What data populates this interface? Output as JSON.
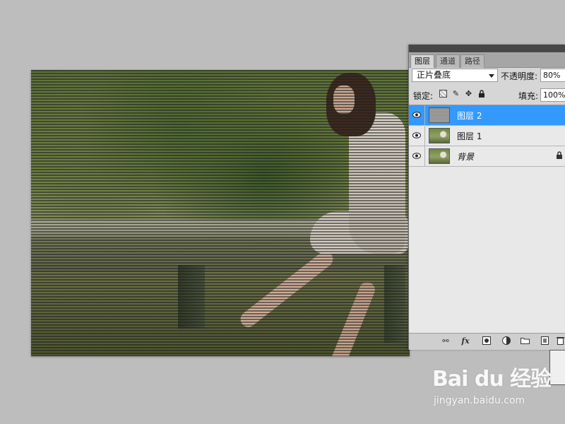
{
  "panel": {
    "tabs": [
      {
        "label": "图层",
        "active": true
      },
      {
        "label": "通道",
        "active": false
      },
      {
        "label": "路径",
        "active": false
      }
    ],
    "blend_mode": "正片叠底",
    "opacity_label": "不透明度:",
    "opacity_value": "80%",
    "lock_label": "锁定:",
    "fill_label": "填充:",
    "fill_value": "100%",
    "layers": [
      {
        "name": "图层 2",
        "selected": true,
        "visible": true
      },
      {
        "name": "图层 1",
        "selected": false,
        "visible": true
      },
      {
        "name": "背景",
        "selected": false,
        "visible": true,
        "locked": true
      }
    ],
    "bottom_icons": [
      "link-icon",
      "fx-icon",
      "mask-icon",
      "adjustment-icon",
      "folder-icon",
      "new-layer-icon",
      "trash-icon"
    ],
    "selected_color": "#3399ff"
  },
  "watermark": {
    "logo": "Bai du 经验",
    "url": "jingyan.baidu.com"
  }
}
